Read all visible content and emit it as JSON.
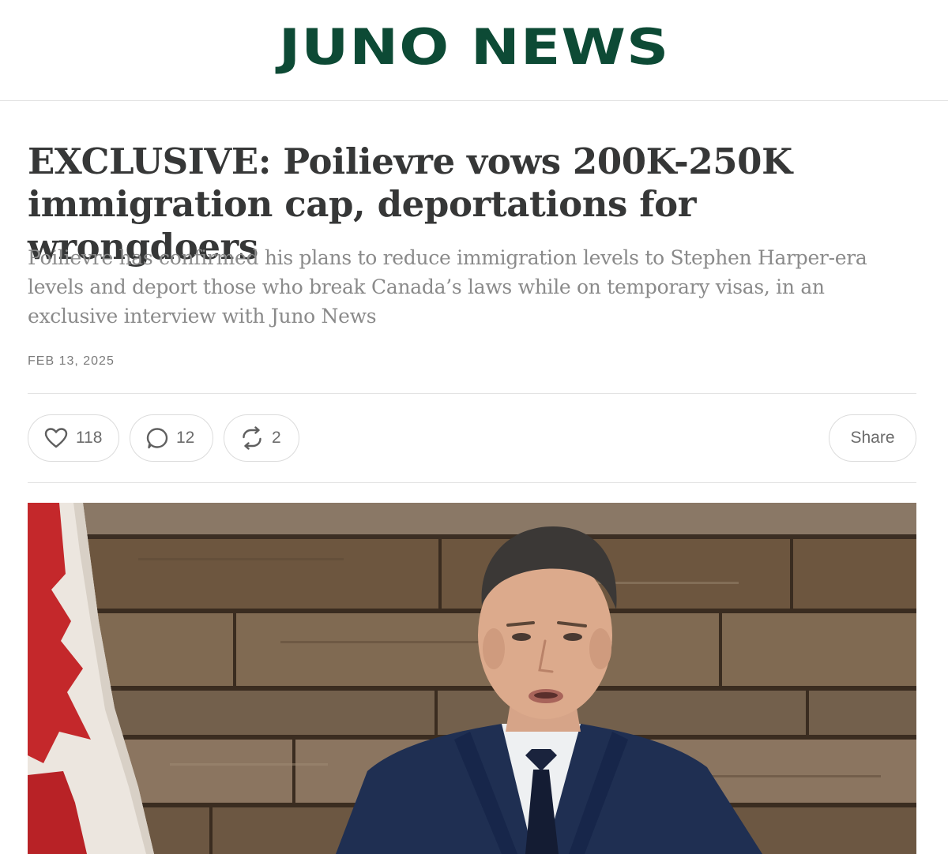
{
  "masthead": {
    "logo_text": "JUNO NEWS",
    "brand_color": "#0d4a35"
  },
  "article": {
    "title": "EXCLUSIVE: Poilievre vows 200K-250K immigration cap, deportations for wrongdoers",
    "subtitle": "Poilievre has confirmed his plans to reduce immigration levels to Stephen Harper-era levels and deport those who break Canada’s laws while on temporary visas, in an exclusive interview with Juno News",
    "date": "FEB 13, 2025"
  },
  "actions": {
    "like": {
      "icon": "heart-icon",
      "count": "118"
    },
    "comment": {
      "icon": "speech-bubble-icon",
      "count": "12"
    },
    "restack": {
      "icon": "restack-arrows-icon",
      "count": "2"
    },
    "share_label": "Share"
  },
  "hero_image": {
    "subject": "man-in-suit-icon",
    "background": "wood-wall-with-flag"
  }
}
